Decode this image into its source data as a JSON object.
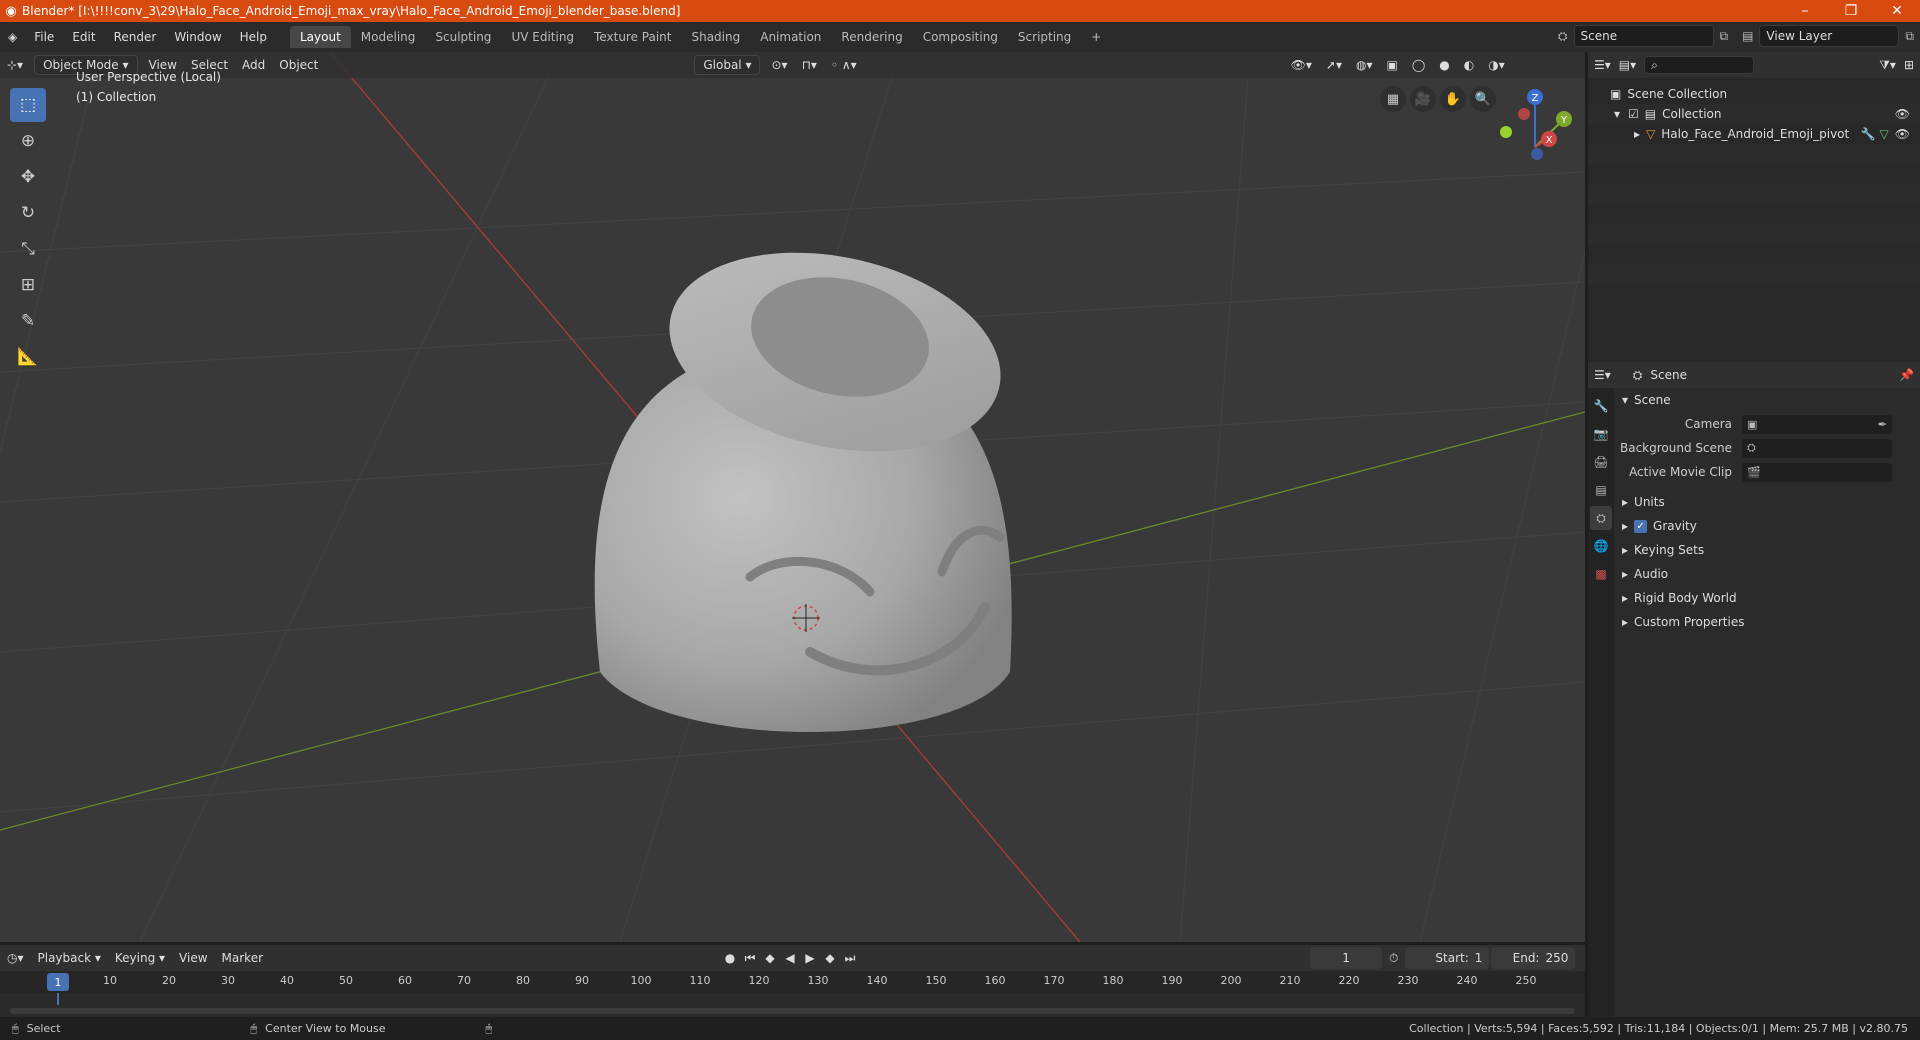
{
  "titlebar": {
    "title": "Blender* [I:\\!!!!conv_3\\29\\Halo_Face_Android_Emoji_max_vray\\Halo_Face_Android_Emoji_blender_base.blend]",
    "minimize": "–",
    "restore": "❐",
    "close": "✕"
  },
  "menu": [
    "File",
    "Edit",
    "Render",
    "Window",
    "Help"
  ],
  "workspaces": [
    "Layout",
    "Modeling",
    "Sculpting",
    "UV Editing",
    "Texture Paint",
    "Shading",
    "Animation",
    "Rendering",
    "Compositing",
    "Scripting"
  ],
  "add_workspace": "+",
  "scene_field": "Scene",
  "view_layer_field": "View Layer",
  "viewport": {
    "mode": "Object Mode",
    "menus": [
      "View",
      "Select",
      "Add",
      "Object"
    ],
    "orientation": "Global",
    "overlay_line1": "User Perspective (Local)",
    "overlay_line2": "(1) Collection",
    "gizmo": {
      "x": "X",
      "y": "Y",
      "z": "Z"
    }
  },
  "outliner": {
    "rows": [
      {
        "label": "Scene Collection"
      },
      {
        "label": "Collection"
      },
      {
        "label": "Halo_Face_Android_Emoji_pivot"
      }
    ]
  },
  "properties": {
    "header": "Scene",
    "panel": "Scene",
    "fields": [
      {
        "label": "Camera",
        "value": ""
      },
      {
        "label": "Background Scene",
        "value": ""
      },
      {
        "label": "Active Movie Clip",
        "value": ""
      }
    ],
    "subpanels": [
      "Units",
      "Gravity",
      "Keying Sets",
      "Audio",
      "Rigid Body World",
      "Custom Properties"
    ]
  },
  "timeline": {
    "menus": [
      "Playback",
      "Keying",
      "View",
      "Marker"
    ],
    "current_frame": "1",
    "start_label": "Start:",
    "start": "1",
    "end_label": "End:",
    "end": "250",
    "ticks": [
      "10",
      "20",
      "30",
      "40",
      "50",
      "60",
      "70",
      "80",
      "90",
      "100",
      "110",
      "120",
      "130",
      "140",
      "150",
      "160",
      "170",
      "180",
      "190",
      "200",
      "210",
      "220",
      "230",
      "240",
      "250"
    ],
    "frame_badge": "1"
  },
  "statusbar": {
    "select": "Select",
    "center_view": "Center View to Mouse",
    "stats": "Collection | Verts:5,594 | Faces:5,592 | Tris:11,184 | Objects:0/1 | Mem: 25.7 MB | v2.80.75"
  }
}
